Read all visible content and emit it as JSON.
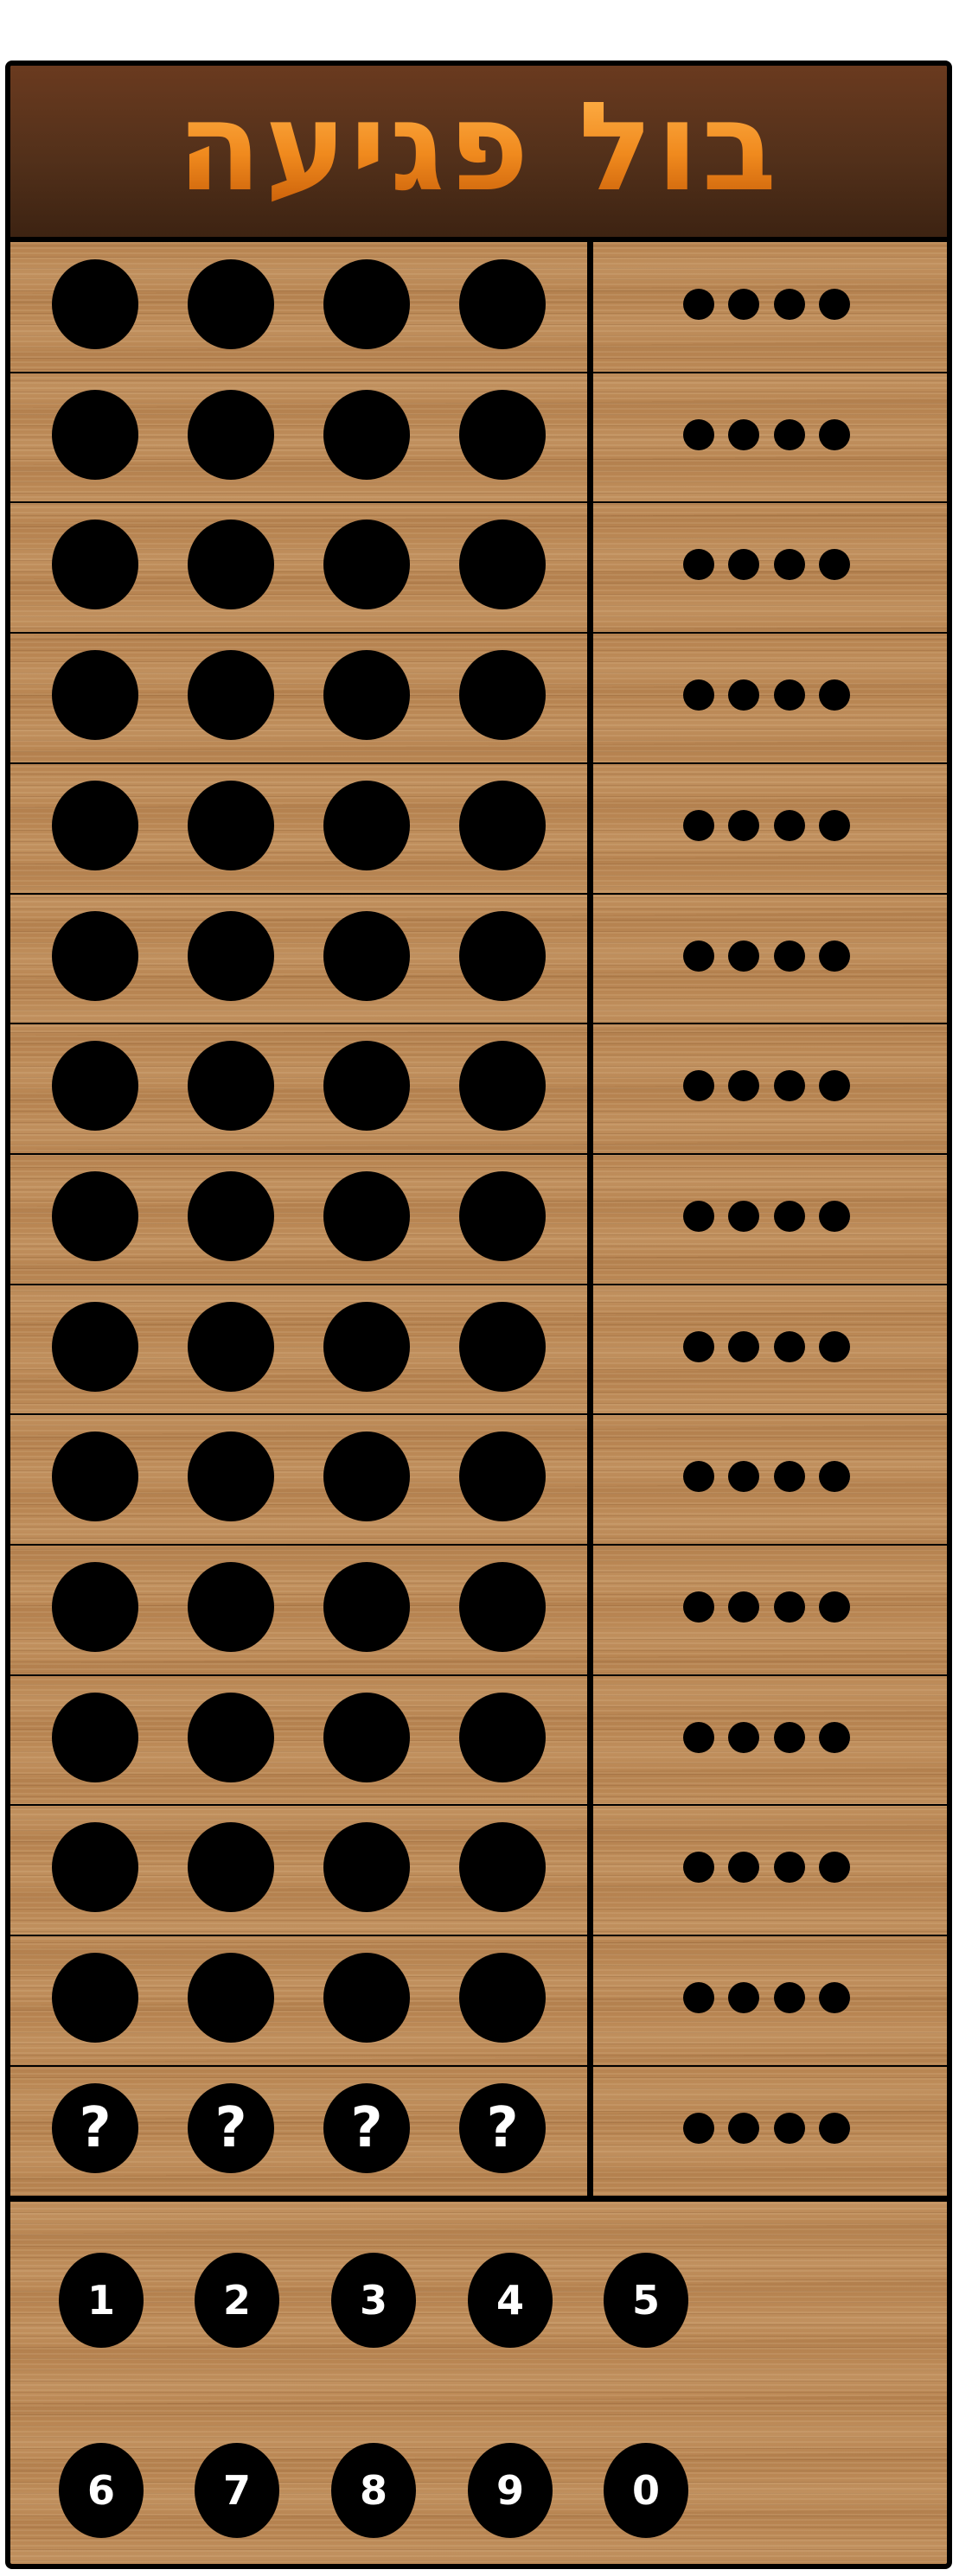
{
  "title": "בול פגיעה",
  "board": {
    "rows": 15,
    "pegs_per_row": 4,
    "feedback_dots_per_row": 4,
    "secret_row_symbol": "?",
    "colors": {
      "header_bg": "#52301a",
      "title_orange": "#f08a1e",
      "wood": "#b98653",
      "peg": "#000000",
      "digit_text": "#ffffff"
    }
  },
  "keypad": {
    "row1": [
      "1",
      "2",
      "3",
      "4",
      "5"
    ],
    "row2": [
      "6",
      "7",
      "8",
      "9",
      "0"
    ]
  }
}
